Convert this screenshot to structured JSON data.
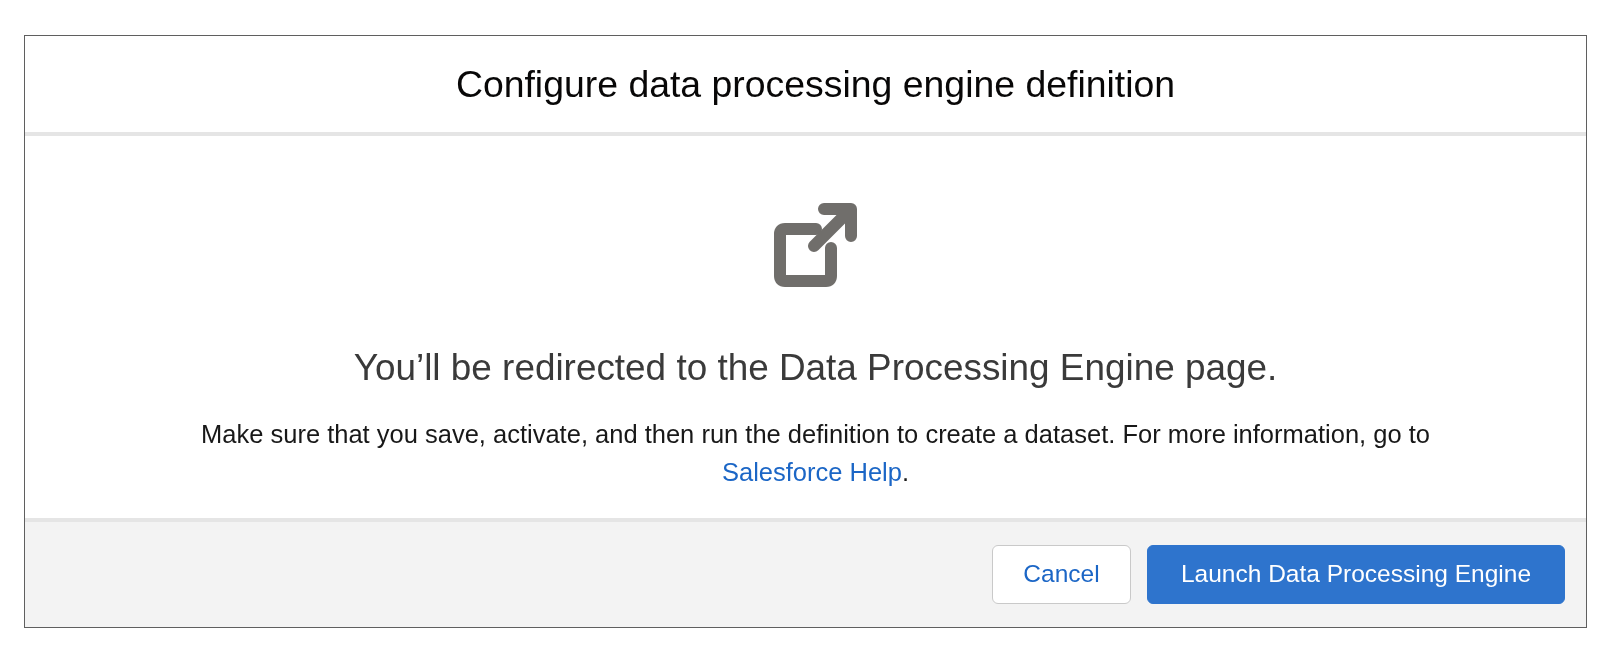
{
  "modal": {
    "title": "Configure data processing engine definition"
  },
  "body": {
    "heading": "You’ll be redirected to the Data Processing Engine page.",
    "message": [
      {
        "kind": "text",
        "text": "Make sure that you save, activate, and then run the definition to create a dataset. For more information, go to "
      },
      {
        "kind": "link",
        "text": "Salesforce Help"
      },
      {
        "kind": "text",
        "text": "."
      }
    ]
  },
  "footer": {
    "buttons": [
      {
        "kind": "neutral",
        "label": "Cancel"
      },
      {
        "kind": "brand",
        "label": "Launch Data Processing Engine"
      }
    ]
  }
}
